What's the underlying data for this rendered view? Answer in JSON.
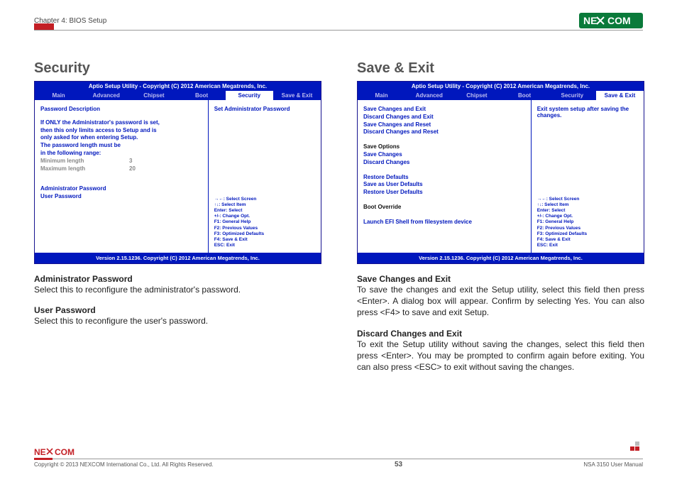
{
  "header": {
    "chapter": "Chapter 4: BIOS Setup",
    "logo_text_1": "NE",
    "logo_text_2": "COM"
  },
  "left": {
    "title": "Security",
    "bios": {
      "title": "Aptio Setup Utility - Copyright (C) 2012 American Megatrends, Inc.",
      "tabs": [
        "Main",
        "Advanced",
        "Chipset",
        "Boot",
        "Security",
        "Save & Exit"
      ],
      "active_tab": "Security",
      "footer": "Version 2.15.1236. Copyright (C) 2012 American Megatrends, Inc.",
      "pw_desc_title": "Password Description",
      "pw_desc_l1": "If ONLY the Administrator's password is set,",
      "pw_desc_l2": "then this only limits access to Setup and is",
      "pw_desc_l3": "only asked for when entering Setup.",
      "pw_desc_l4": "The password length must be",
      "pw_desc_l5": "in the following range:",
      "min_label": "Minimum length",
      "min_val": "3",
      "max_label": "Maximum length",
      "max_val": "20",
      "admin_pw": "Administrator Password",
      "user_pw": "User Password",
      "help_top": "Set Administrator Password",
      "help_lines": [
        "→←: Select Screen",
        "↑↓: Select Item",
        "Enter: Select",
        "+/-: Change Opt.",
        "F1: General Help",
        "F2: Previous Values",
        "F3: Optimized Defaults",
        "F4: Save & Exit",
        "ESC: Exit"
      ]
    },
    "desc1_title": "Administrator Password",
    "desc1_text": "Select this to reconfigure the administrator's password.",
    "desc2_title": "User Password",
    "desc2_text": "Select this to reconfigure the user's password."
  },
  "right": {
    "title": "Save & Exit",
    "bios": {
      "title": "Aptio Setup Utility - Copyright (C) 2012 American Megatrends, Inc.",
      "tabs": [
        "Main",
        "Advanced",
        "Chipset",
        "Boot",
        "Security",
        "Save & Exit"
      ],
      "active_tab": "Save & Exit",
      "footer": "Version 2.15.1236. Copyright (C) 2012 American Megatrends, Inc.",
      "items_top": [
        "Save Changes and Exit",
        "Discard Changes and Exit",
        "Save Changes and Reset",
        "Discard Changes and Reset"
      ],
      "save_options_label": "Save Options",
      "save_changes": "Save Changes",
      "discard_changes": "Discard Changes",
      "restore_defaults": "Restore Defaults",
      "save_user_defaults": "Save as User Defaults",
      "restore_user_defaults": "Restore User Defaults",
      "boot_override": "Boot Override",
      "launch_efi": "Launch EFI Shell from filesystem device",
      "help_top": "Exit system setup after saving the changes.",
      "help_lines": [
        "→←: Select Screen",
        "↑↓: Select Item",
        "Enter: Select",
        "+/-: Change Opt.",
        "F1: General Help",
        "F2: Previous Values",
        "F3: Optimized Defaults",
        "F4: Save & Exit",
        "ESC: Exit"
      ]
    },
    "desc1_title": "Save Changes and Exit",
    "desc1_text": "To save the changes and exit the Setup utility, select this field then press <Enter>. A dialog box will appear. Confirm by selecting Yes. You can also press <F4> to save and exit Setup.",
    "desc2_title": "Discard Changes and Exit",
    "desc2_text": "To exit the Setup utility without saving the changes, select this field then press <Enter>. You may be prompted to confirm again before exiting. You can also press <ESC> to exit without saving the changes."
  },
  "footer": {
    "copyright": "Copyright © 2013 NEXCOM International Co., Ltd. All Rights Reserved.",
    "page_no": "53",
    "manual": "NSA 3150 User Manual"
  }
}
